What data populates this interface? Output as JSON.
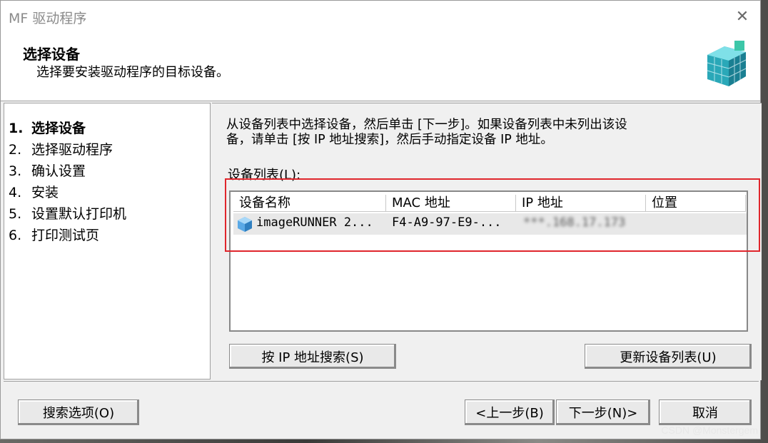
{
  "window": {
    "title": "MF 驱动程序",
    "close_glyph": "✕"
  },
  "header": {
    "title": "选择设备",
    "subtitle": "选择要安装驱动程序的目标设备。",
    "icon": "cube-stack-icon"
  },
  "steps": [
    {
      "num": "1.",
      "label": "选择设备",
      "active": true
    },
    {
      "num": "2.",
      "label": "选择驱动程序",
      "active": false
    },
    {
      "num": "3.",
      "label": "确认设置",
      "active": false
    },
    {
      "num": "4.",
      "label": "安装",
      "active": false
    },
    {
      "num": "5.",
      "label": "设置默认打印机",
      "active": false
    },
    {
      "num": "6.",
      "label": "打印测试页",
      "active": false
    }
  ],
  "main": {
    "instruction_line1": "从设备列表中选择设备，然后单击 [下一步]。如果设备列表中未列出该设",
    "instruction_line2": "备，请单击 [按 IP 地址搜索]，然后手动指定设备 IP 地址。",
    "list_label": "设备列表(L):",
    "columns": [
      "设备名称",
      "MAC 地址",
      "IP 地址",
      "位置"
    ],
    "rows": [
      {
        "name": "imageRUNNER 2...",
        "mac": "F4-A9-97-E9-...",
        "ip": "***.168.17.173",
        "location": ""
      }
    ],
    "search_ip_button": "按 IP 地址搜索(S)",
    "refresh_button": "更新设备列表(U)"
  },
  "footer": {
    "options_button": "搜索选项(O)",
    "back_button": "<上一步(B)",
    "next_button": "下一步(N)>",
    "cancel_button": "取消"
  },
  "watermark": "CSDN @Monstergem",
  "colors": {
    "highlight": "#e0262c",
    "window_bg": "#f0f0f0"
  }
}
